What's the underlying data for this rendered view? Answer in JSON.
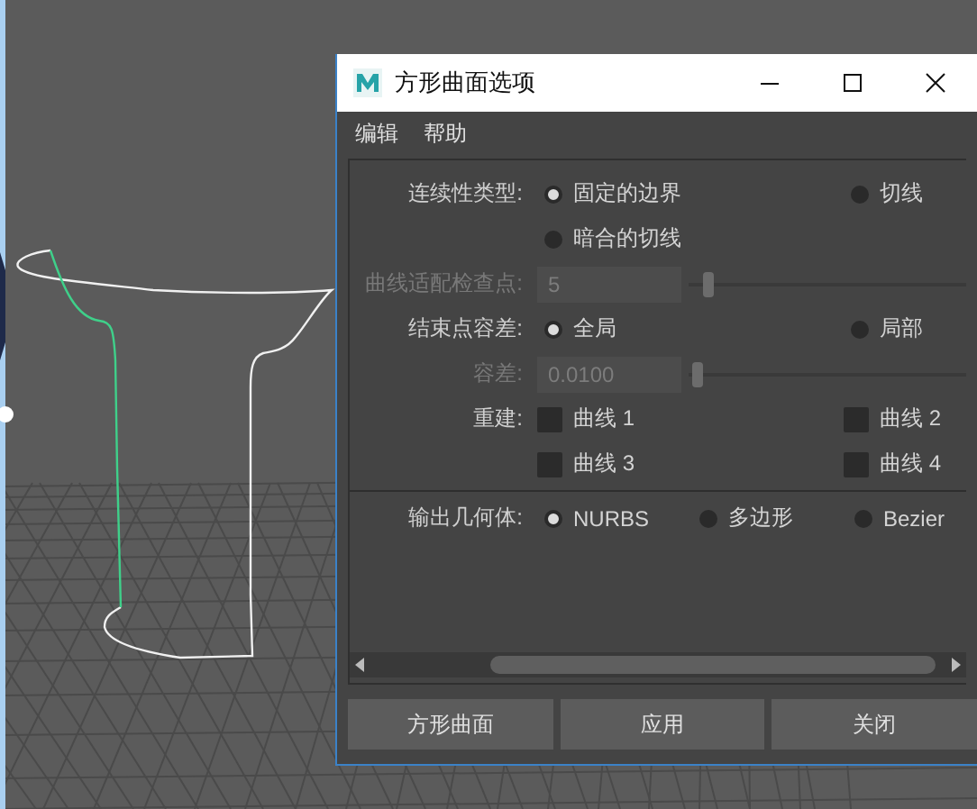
{
  "window": {
    "title": "方形曲面选项"
  },
  "menu": [
    "编辑",
    "帮助"
  ],
  "sections": [
    {
      "rows": [
        {
          "kind": "radio",
          "label": "连续性类型:",
          "options": [
            {
              "label": "固定的边界",
              "selected": true
            },
            {
              "label": "切线",
              "selected": false
            },
            {
              "label": "暗合的切线",
              "selected": false
            }
          ]
        },
        {
          "kind": "field-slider",
          "label": "曲线适配检查点:",
          "disabled": true,
          "value": "5",
          "level": 0.07
        },
        {
          "kind": "radio",
          "label": "结束点容差:",
          "options": [
            {
              "label": "全局",
              "selected": true
            },
            {
              "label": "局部",
              "selected": false
            }
          ]
        },
        {
          "kind": "field-slider",
          "label": "容差:",
          "disabled": true,
          "value": "0.0100",
          "level": 0.03
        },
        {
          "kind": "checkbox",
          "label": "重建:",
          "options": [
            {
              "label": "曲线 1",
              "checked": false
            },
            {
              "label": "曲线 2",
              "checked": false
            },
            {
              "label": "曲线 3",
              "checked": false
            },
            {
              "label": "曲线 4",
              "checked": false
            }
          ]
        }
      ]
    },
    {
      "rows": [
        {
          "kind": "radio-row",
          "label": "输出几何体:",
          "options": [
            {
              "label": "NURBS",
              "selected": true
            },
            {
              "label": "多边形",
              "selected": false
            },
            {
              "label": "Bezier",
              "selected": false
            }
          ]
        }
      ]
    }
  ],
  "buttons": [
    "方形曲面",
    "应用",
    "关闭"
  ]
}
